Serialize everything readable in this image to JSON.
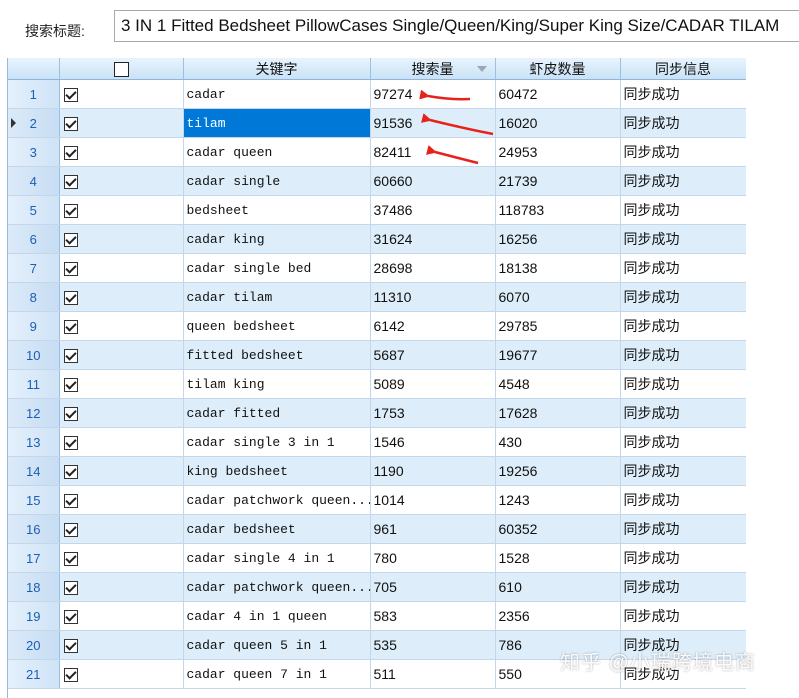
{
  "search": {
    "label": "搜索标题:",
    "value": "3 IN 1 Fitted Bedsheet PillowCases Single/Queen/King/Super King Size/CADAR TILAM"
  },
  "table": {
    "columns": [
      "",
      "",
      "关键字",
      "搜索量",
      "虾皮数量",
      "同步信息"
    ],
    "selected_row": 2,
    "rows": [
      {
        "n": "1",
        "keyword": "cadar",
        "volume": "97274",
        "count": "60472",
        "status": "同步成功"
      },
      {
        "n": "2",
        "keyword": "tilam",
        "volume": "91536",
        "count": "16020",
        "status": "同步成功"
      },
      {
        "n": "3",
        "keyword": "cadar queen",
        "volume": "82411",
        "count": "24953",
        "status": "同步成功"
      },
      {
        "n": "4",
        "keyword": "cadar single",
        "volume": "60660",
        "count": "21739",
        "status": "同步成功"
      },
      {
        "n": "5",
        "keyword": "bedsheet",
        "volume": "37486",
        "count": "118783",
        "status": "同步成功"
      },
      {
        "n": "6",
        "keyword": "cadar king",
        "volume": "31624",
        "count": "16256",
        "status": "同步成功"
      },
      {
        "n": "7",
        "keyword": "cadar single bed",
        "volume": "28698",
        "count": "18138",
        "status": "同步成功"
      },
      {
        "n": "8",
        "keyword": "cadar tilam",
        "volume": "11310",
        "count": "6070",
        "status": "同步成功"
      },
      {
        "n": "9",
        "keyword": "queen bedsheet",
        "volume": "6142",
        "count": "29785",
        "status": "同步成功"
      },
      {
        "n": "10",
        "keyword": "fitted bedsheet",
        "volume": "5687",
        "count": "19677",
        "status": "同步成功"
      },
      {
        "n": "11",
        "keyword": "tilam king",
        "volume": "5089",
        "count": "4548",
        "status": "同步成功"
      },
      {
        "n": "12",
        "keyword": "cadar fitted",
        "volume": "1753",
        "count": "17628",
        "status": "同步成功"
      },
      {
        "n": "13",
        "keyword": "cadar single 3 in 1",
        "volume": "1546",
        "count": "430",
        "status": "同步成功"
      },
      {
        "n": "14",
        "keyword": "king bedsheet",
        "volume": "1190",
        "count": "19256",
        "status": "同步成功"
      },
      {
        "n": "15",
        "keyword": "cadar patchwork queen...",
        "volume": "1014",
        "count": "1243",
        "status": "同步成功"
      },
      {
        "n": "16",
        "keyword": "cadar bedsheet",
        "volume": "961",
        "count": "60352",
        "status": "同步成功"
      },
      {
        "n": "17",
        "keyword": "cadar single 4 in 1",
        "volume": "780",
        "count": "1528",
        "status": "同步成功"
      },
      {
        "n": "18",
        "keyword": "cadar patchwork queen...",
        "volume": "705",
        "count": "610",
        "status": "同步成功"
      },
      {
        "n": "19",
        "keyword": "cadar 4 in 1 queen",
        "volume": "583",
        "count": "2356",
        "status": "同步成功"
      },
      {
        "n": "20",
        "keyword": "cadar queen 5 in 1",
        "volume": "535",
        "count": "786",
        "status": "同步成功"
      },
      {
        "n": "21",
        "keyword": "cadar queen 7 in 1",
        "volume": "511",
        "count": "550",
        "status": "同步成功"
      }
    ]
  },
  "annotation_color": "#e5231b",
  "watermark": "知乎 @小瑞跨境电商"
}
